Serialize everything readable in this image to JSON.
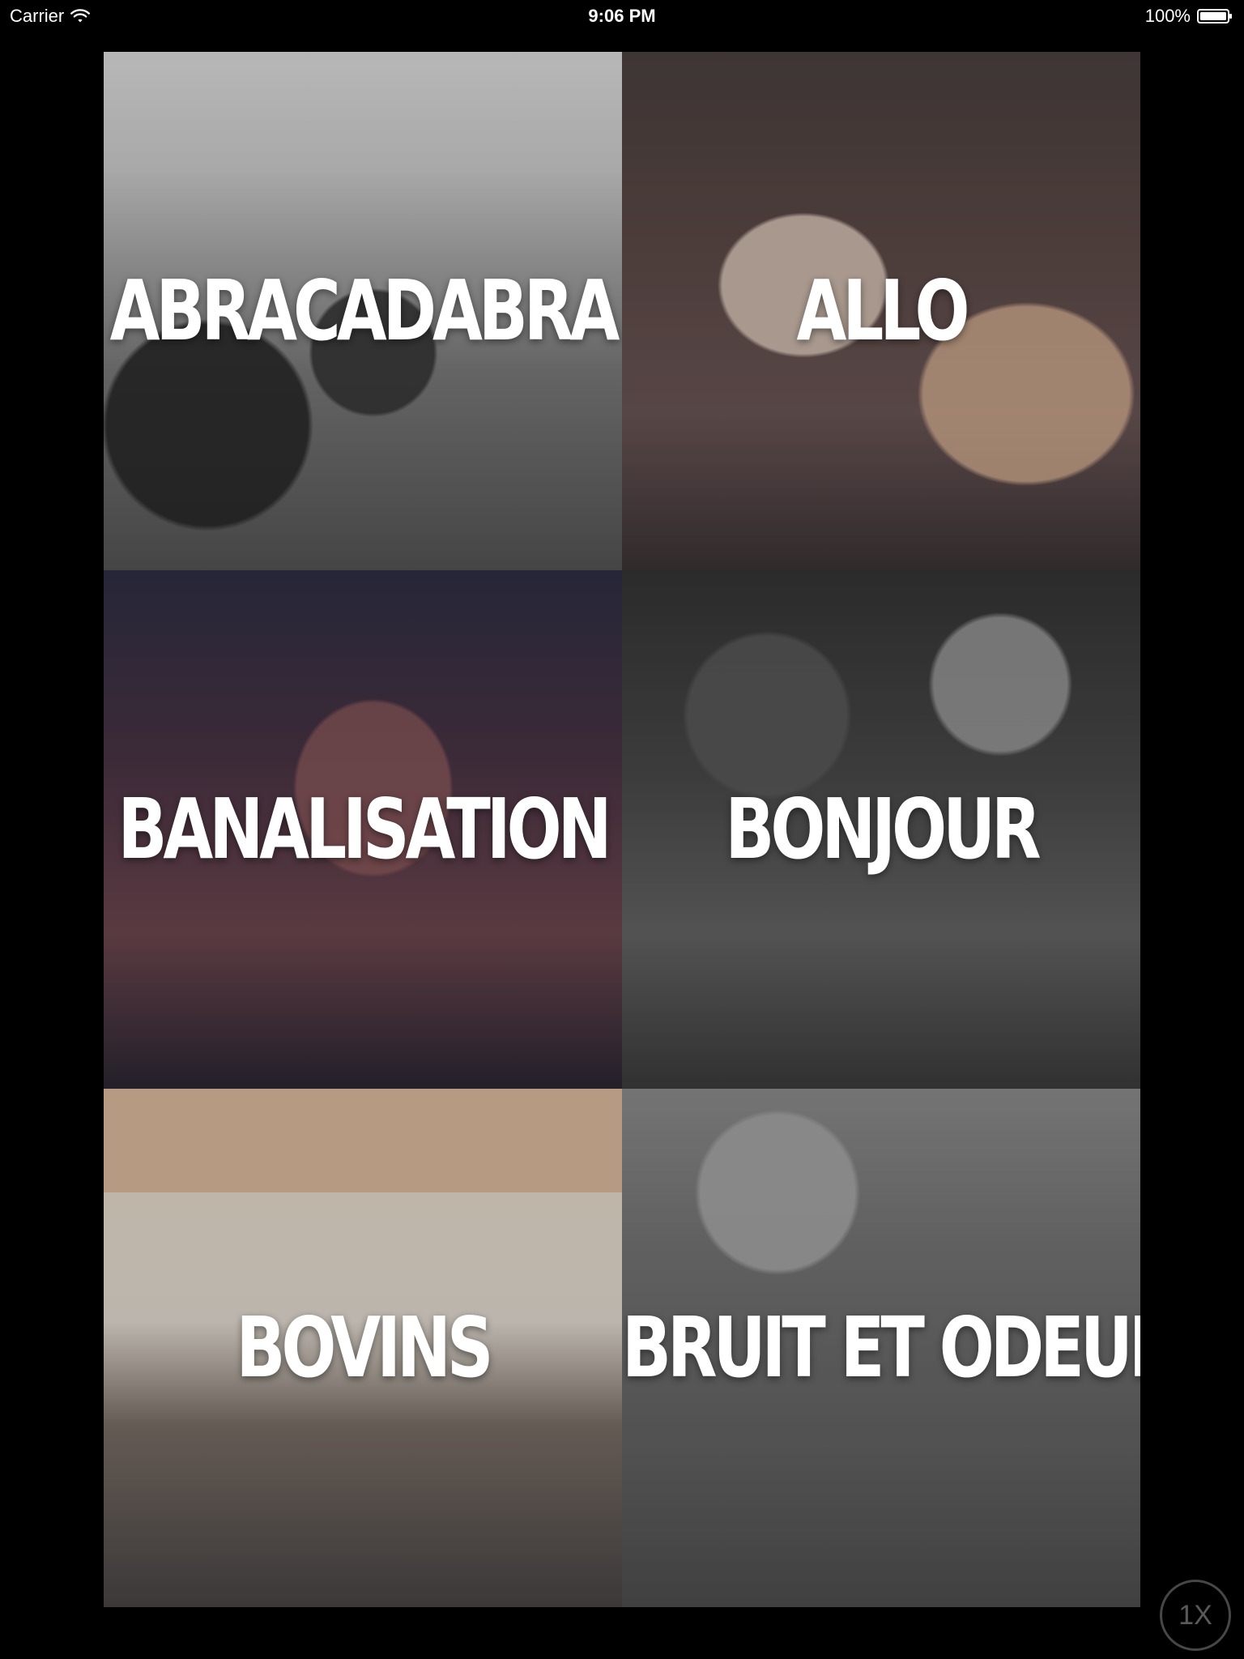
{
  "status_bar": {
    "carrier": "Carrier",
    "time": "9:06 PM",
    "battery": "100%"
  },
  "tiles": [
    {
      "label": "ABRACADABRA"
    },
    {
      "label": "ALLO"
    },
    {
      "label": "BANALISATION"
    },
    {
      "label": "BONJOUR"
    },
    {
      "label": "BOVINS"
    },
    {
      "label": "BRUIT ET ODEUR"
    }
  ],
  "speed_button": {
    "label": "1X"
  },
  "colors": {
    "background": "#000000",
    "text": "#ffffff"
  }
}
